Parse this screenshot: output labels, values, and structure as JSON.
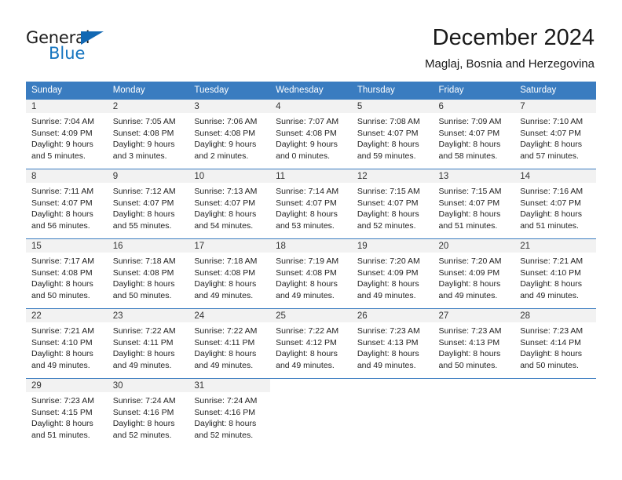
{
  "brand": {
    "name_part1": "General",
    "name_part2": "Blue",
    "triangle_color": "#1268b3",
    "blue_color": "#1574bf"
  },
  "header": {
    "title": "December 2024",
    "subtitle": "Maglaj, Bosnia and Herzegovina"
  },
  "theme": {
    "header_row_bg": "#3a7cc0",
    "header_row_text": "#ffffff",
    "day_band_bg": "#f2f2f2",
    "cell_border": "#3a7cc0"
  },
  "weekdays": [
    "Sunday",
    "Monday",
    "Tuesday",
    "Wednesday",
    "Thursday",
    "Friday",
    "Saturday"
  ],
  "weeks": [
    [
      {
        "day": "1",
        "sunrise": "Sunrise: 7:04 AM",
        "sunset": "Sunset: 4:09 PM",
        "daylight1": "Daylight: 9 hours",
        "daylight2": "and 5 minutes."
      },
      {
        "day": "2",
        "sunrise": "Sunrise: 7:05 AM",
        "sunset": "Sunset: 4:08 PM",
        "daylight1": "Daylight: 9 hours",
        "daylight2": "and 3 minutes."
      },
      {
        "day": "3",
        "sunrise": "Sunrise: 7:06 AM",
        "sunset": "Sunset: 4:08 PM",
        "daylight1": "Daylight: 9 hours",
        "daylight2": "and 2 minutes."
      },
      {
        "day": "4",
        "sunrise": "Sunrise: 7:07 AM",
        "sunset": "Sunset: 4:08 PM",
        "daylight1": "Daylight: 9 hours",
        "daylight2": "and 0 minutes."
      },
      {
        "day": "5",
        "sunrise": "Sunrise: 7:08 AM",
        "sunset": "Sunset: 4:07 PM",
        "daylight1": "Daylight: 8 hours",
        "daylight2": "and 59 minutes."
      },
      {
        "day": "6",
        "sunrise": "Sunrise: 7:09 AM",
        "sunset": "Sunset: 4:07 PM",
        "daylight1": "Daylight: 8 hours",
        "daylight2": "and 58 minutes."
      },
      {
        "day": "7",
        "sunrise": "Sunrise: 7:10 AM",
        "sunset": "Sunset: 4:07 PM",
        "daylight1": "Daylight: 8 hours",
        "daylight2": "and 57 minutes."
      }
    ],
    [
      {
        "day": "8",
        "sunrise": "Sunrise: 7:11 AM",
        "sunset": "Sunset: 4:07 PM",
        "daylight1": "Daylight: 8 hours",
        "daylight2": "and 56 minutes."
      },
      {
        "day": "9",
        "sunrise": "Sunrise: 7:12 AM",
        "sunset": "Sunset: 4:07 PM",
        "daylight1": "Daylight: 8 hours",
        "daylight2": "and 55 minutes."
      },
      {
        "day": "10",
        "sunrise": "Sunrise: 7:13 AM",
        "sunset": "Sunset: 4:07 PM",
        "daylight1": "Daylight: 8 hours",
        "daylight2": "and 54 minutes."
      },
      {
        "day": "11",
        "sunrise": "Sunrise: 7:14 AM",
        "sunset": "Sunset: 4:07 PM",
        "daylight1": "Daylight: 8 hours",
        "daylight2": "and 53 minutes."
      },
      {
        "day": "12",
        "sunrise": "Sunrise: 7:15 AM",
        "sunset": "Sunset: 4:07 PM",
        "daylight1": "Daylight: 8 hours",
        "daylight2": "and 52 minutes."
      },
      {
        "day": "13",
        "sunrise": "Sunrise: 7:15 AM",
        "sunset": "Sunset: 4:07 PM",
        "daylight1": "Daylight: 8 hours",
        "daylight2": "and 51 minutes."
      },
      {
        "day": "14",
        "sunrise": "Sunrise: 7:16 AM",
        "sunset": "Sunset: 4:07 PM",
        "daylight1": "Daylight: 8 hours",
        "daylight2": "and 51 minutes."
      }
    ],
    [
      {
        "day": "15",
        "sunrise": "Sunrise: 7:17 AM",
        "sunset": "Sunset: 4:08 PM",
        "daylight1": "Daylight: 8 hours",
        "daylight2": "and 50 minutes."
      },
      {
        "day": "16",
        "sunrise": "Sunrise: 7:18 AM",
        "sunset": "Sunset: 4:08 PM",
        "daylight1": "Daylight: 8 hours",
        "daylight2": "and 50 minutes."
      },
      {
        "day": "17",
        "sunrise": "Sunrise: 7:18 AM",
        "sunset": "Sunset: 4:08 PM",
        "daylight1": "Daylight: 8 hours",
        "daylight2": "and 49 minutes."
      },
      {
        "day": "18",
        "sunrise": "Sunrise: 7:19 AM",
        "sunset": "Sunset: 4:08 PM",
        "daylight1": "Daylight: 8 hours",
        "daylight2": "and 49 minutes."
      },
      {
        "day": "19",
        "sunrise": "Sunrise: 7:20 AM",
        "sunset": "Sunset: 4:09 PM",
        "daylight1": "Daylight: 8 hours",
        "daylight2": "and 49 minutes."
      },
      {
        "day": "20",
        "sunrise": "Sunrise: 7:20 AM",
        "sunset": "Sunset: 4:09 PM",
        "daylight1": "Daylight: 8 hours",
        "daylight2": "and 49 minutes."
      },
      {
        "day": "21",
        "sunrise": "Sunrise: 7:21 AM",
        "sunset": "Sunset: 4:10 PM",
        "daylight1": "Daylight: 8 hours",
        "daylight2": "and 49 minutes."
      }
    ],
    [
      {
        "day": "22",
        "sunrise": "Sunrise: 7:21 AM",
        "sunset": "Sunset: 4:10 PM",
        "daylight1": "Daylight: 8 hours",
        "daylight2": "and 49 minutes."
      },
      {
        "day": "23",
        "sunrise": "Sunrise: 7:22 AM",
        "sunset": "Sunset: 4:11 PM",
        "daylight1": "Daylight: 8 hours",
        "daylight2": "and 49 minutes."
      },
      {
        "day": "24",
        "sunrise": "Sunrise: 7:22 AM",
        "sunset": "Sunset: 4:11 PM",
        "daylight1": "Daylight: 8 hours",
        "daylight2": "and 49 minutes."
      },
      {
        "day": "25",
        "sunrise": "Sunrise: 7:22 AM",
        "sunset": "Sunset: 4:12 PM",
        "daylight1": "Daylight: 8 hours",
        "daylight2": "and 49 minutes."
      },
      {
        "day": "26",
        "sunrise": "Sunrise: 7:23 AM",
        "sunset": "Sunset: 4:13 PM",
        "daylight1": "Daylight: 8 hours",
        "daylight2": "and 49 minutes."
      },
      {
        "day": "27",
        "sunrise": "Sunrise: 7:23 AM",
        "sunset": "Sunset: 4:13 PM",
        "daylight1": "Daylight: 8 hours",
        "daylight2": "and 50 minutes."
      },
      {
        "day": "28",
        "sunrise": "Sunrise: 7:23 AM",
        "sunset": "Sunset: 4:14 PM",
        "daylight1": "Daylight: 8 hours",
        "daylight2": "and 50 minutes."
      }
    ],
    [
      {
        "day": "29",
        "sunrise": "Sunrise: 7:23 AM",
        "sunset": "Sunset: 4:15 PM",
        "daylight1": "Daylight: 8 hours",
        "daylight2": "and 51 minutes."
      },
      {
        "day": "30",
        "sunrise": "Sunrise: 7:24 AM",
        "sunset": "Sunset: 4:16 PM",
        "daylight1": "Daylight: 8 hours",
        "daylight2": "and 52 minutes."
      },
      {
        "day": "31",
        "sunrise": "Sunrise: 7:24 AM",
        "sunset": "Sunset: 4:16 PM",
        "daylight1": "Daylight: 8 hours",
        "daylight2": "and 52 minutes."
      },
      {
        "day": "",
        "sunrise": "",
        "sunset": "",
        "daylight1": "",
        "daylight2": ""
      },
      {
        "day": "",
        "sunrise": "",
        "sunset": "",
        "daylight1": "",
        "daylight2": ""
      },
      {
        "day": "",
        "sunrise": "",
        "sunset": "",
        "daylight1": "",
        "daylight2": ""
      },
      {
        "day": "",
        "sunrise": "",
        "sunset": "",
        "daylight1": "",
        "daylight2": ""
      }
    ]
  ]
}
